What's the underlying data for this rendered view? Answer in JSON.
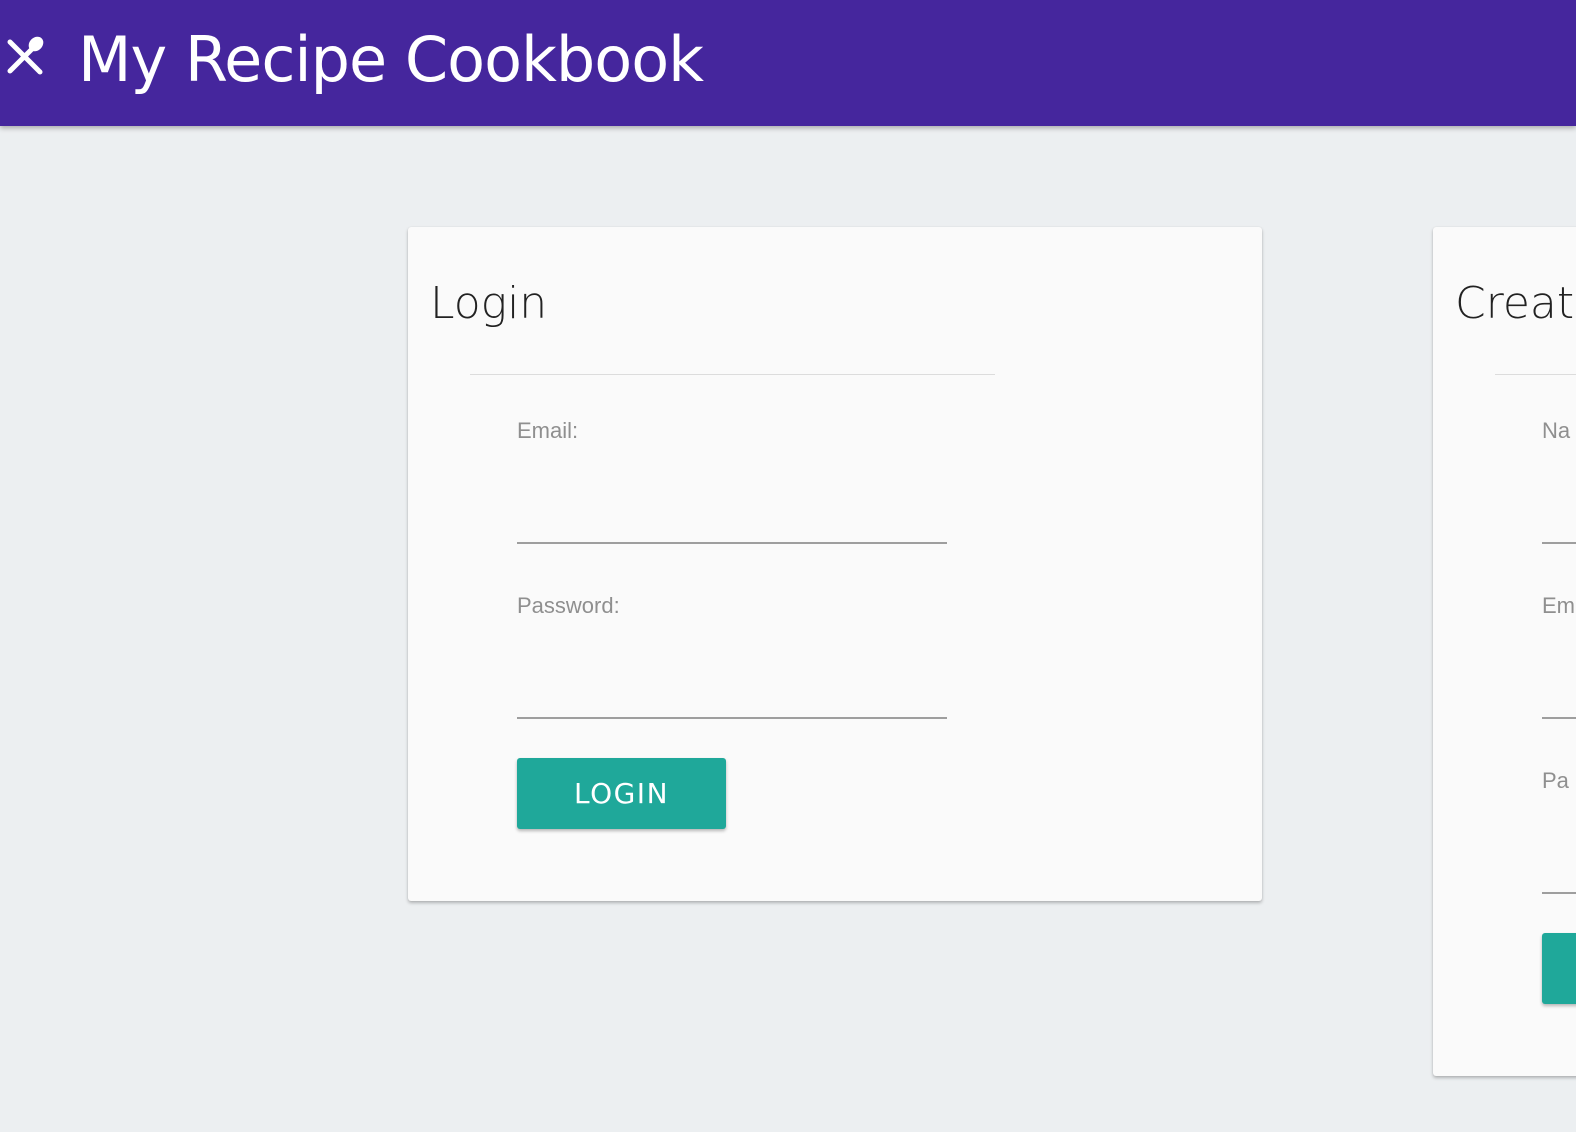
{
  "header": {
    "title": "My Recipe Cookbook",
    "icon": "utensils-icon",
    "background_color": "#45269d"
  },
  "login_card": {
    "title": "Login",
    "fields": [
      {
        "label": "Email:",
        "value": ""
      },
      {
        "label": "Password:",
        "value": ""
      }
    ],
    "button_label": "LOGIN",
    "button_color": "#1fa89a"
  },
  "create_card": {
    "title": "Creat",
    "fields": [
      {
        "label": "Na",
        "value": ""
      },
      {
        "label": "Em",
        "value": ""
      },
      {
        "label": "Pa",
        "value": ""
      }
    ]
  }
}
